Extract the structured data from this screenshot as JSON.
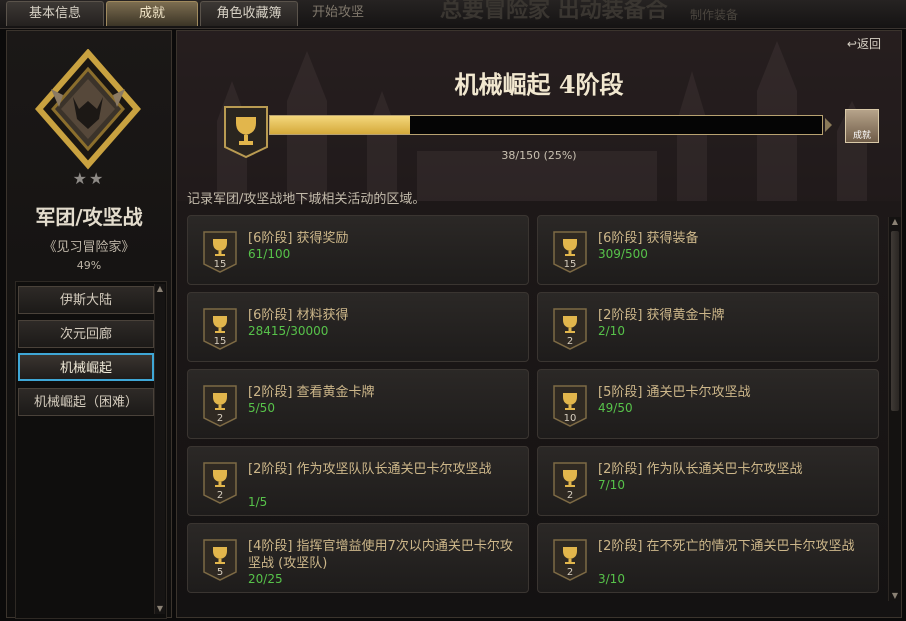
{
  "tabs": [
    {
      "label": "基本信息"
    },
    {
      "label": "成就"
    },
    {
      "label": "角色收藏簿"
    },
    {
      "label": "开始攻坚"
    }
  ],
  "background_banner": "总要冒险家 出动装备合",
  "background_right": "制作装备",
  "category": {
    "title": "军团/攻坚战",
    "subtitle": "《见习冒险家》",
    "percent": "49%",
    "stars": "★★"
  },
  "nav": {
    "items": [
      {
        "label": "伊斯大陆"
      },
      {
        "label": "次元回廊"
      },
      {
        "label": "机械崛起"
      },
      {
        "label": "机械崛起（困难）"
      }
    ],
    "selected_index": 2
  },
  "main": {
    "return_label": "返回",
    "stage_title": "机械崛起 4阶段",
    "progress": {
      "current": 38,
      "total": 150,
      "text": "38/150 (25%)",
      "fraction": 0.2533
    },
    "reward_label": "成就",
    "description": "记录军团/攻坚战地下城相关活动的区域。"
  },
  "achievements": [
    {
      "name": "[6阶段] 获得奖励",
      "progress": "61/100",
      "points": "15"
    },
    {
      "name": "[6阶段] 获得装备",
      "progress": "309/500",
      "points": "15"
    },
    {
      "name": "[6阶段] 材料获得",
      "progress": "28415/30000",
      "points": "15"
    },
    {
      "name": "[2阶段] 获得黄金卡牌",
      "progress": "2/10",
      "points": "2"
    },
    {
      "name": "[2阶段] 查看黄金卡牌",
      "progress": "5/50",
      "points": "2"
    },
    {
      "name": "[5阶段] 通关巴卡尔攻坚战",
      "progress": "49/50",
      "points": "10"
    },
    {
      "name": "[2阶段] 作为攻坚队队长通关巴卡尔攻坚战",
      "progress": "1/5",
      "points": "2"
    },
    {
      "name": "[2阶段] 作为队长通关巴卡尔攻坚战",
      "progress": "7/10",
      "points": "2"
    },
    {
      "name": "[4阶段] 指挥官增益使用7次以内通关巴卡尔攻坚战 (攻坚队)",
      "progress": "20/25",
      "points": "5"
    },
    {
      "name": "[2阶段] 在不死亡的情况下通关巴卡尔攻坚战",
      "progress": "3/10",
      "points": "2"
    }
  ],
  "colors": {
    "gold": "#d4a93a",
    "green": "#57c24a",
    "selection": "#3fa7d6"
  }
}
